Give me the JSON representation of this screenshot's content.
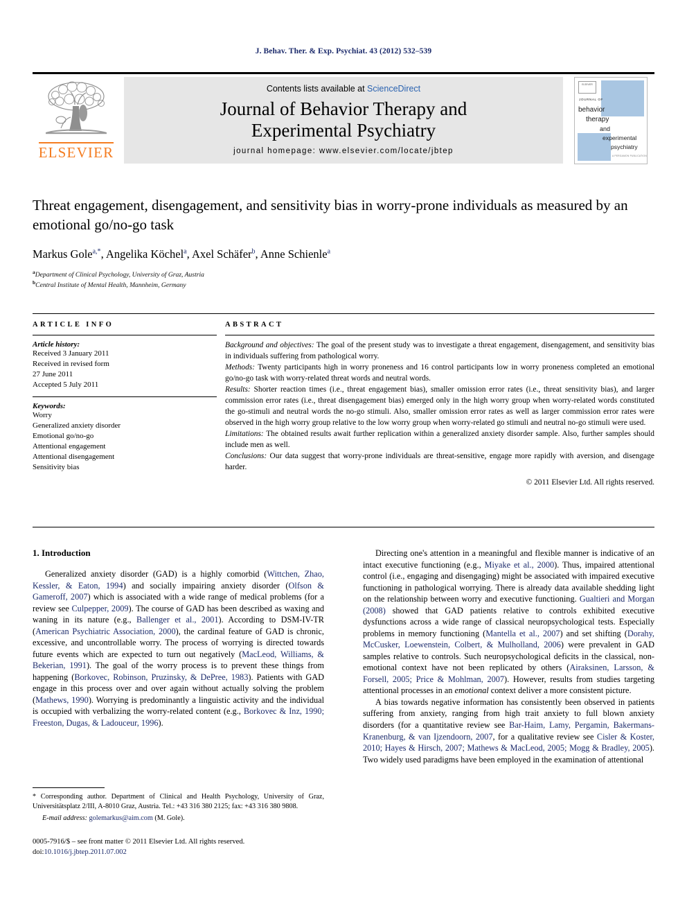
{
  "running_head": "J. Behav. Ther. & Exp. Psychiat. 43 (2012) 532–539",
  "masthead": {
    "publisher_logo_name": "elsevier-tree-logo",
    "publisher_wordmark": "ELSEVIER",
    "contents_prefix": "Contents lists available at ",
    "contents_link": "ScienceDirect",
    "journal_title_line1": "Journal of Behavior Therapy and",
    "journal_title_line2": "Experimental Psychiatry",
    "homepage": "journal homepage: www.elsevier.com/locate/jbtep",
    "cover": {
      "publisher_mark": "ELSEVIER",
      "kicker": "JOURNAL OF",
      "l1": "behavior",
      "l2": "therapy",
      "l3": "and",
      "l4": "experimental",
      "l5": "psychiatry",
      "footer": "A PERGAMON PUBLICATION"
    },
    "colors": {
      "elsevier_orange": "#f47c20",
      "link_blue": "#2b63b0",
      "band_gray": "#e6e6e6",
      "cover_blue": "#a9c6e2"
    }
  },
  "title": "Threat engagement, disengagement, and sensitivity bias in worry-prone individuals as measured by an emotional go/no-go task",
  "authors_html": "Markus Gole<sup class=\"star\">a,*</sup>, Angelika Köchel<sup>a</sup>, Axel Schäfer<sup>b</sup>, Anne Schienle<sup>a</sup>",
  "affiliations": [
    {
      "marker": "a",
      "text": "Department of Clinical Psychology, University of Graz, Austria"
    },
    {
      "marker": "b",
      "text": "Central Institute of Mental Health, Mannheim, Germany"
    }
  ],
  "article_info": {
    "heading": "ARTICLE INFO",
    "history_label": "Article history:",
    "history": [
      "Received 3 January 2011",
      "Received in revised form",
      "27 June 2011",
      "Accepted 5 July 2011"
    ],
    "keywords_label": "Keywords:",
    "keywords": [
      "Worry",
      "Generalized anxiety disorder",
      "Emotional go/no-go",
      "Attentional engagement",
      "Attentional disengagement",
      "Sensitivity bias"
    ]
  },
  "abstract": {
    "heading": "ABSTRACT",
    "sections": [
      {
        "label": "Background and objectives:",
        "text": " The goal of the present study was to investigate a threat engagement, disengagement, and sensitivity bias in individuals suffering from pathological worry."
      },
      {
        "label": "Methods:",
        "text": " Twenty participants high in worry proneness and 16 control participants low in worry proneness completed an emotional go/no-go task with worry-related threat words and neutral words."
      },
      {
        "label": "Results:",
        "text": " Shorter reaction times (i.e., threat engagement bias), smaller omission error rates (i.e., threat sensitivity bias), and larger commission error rates (i.e., threat disengagement bias) emerged only in the high worry group when worry-related words constituted the go-stimuli and neutral words the no-go stimuli. Also, smaller omission error rates as well as larger commission error rates were observed in the high worry group relative to the low worry group when worry-related go stimuli and neutral no-go stimuli were used."
      },
      {
        "label": "Limitations:",
        "text": " The obtained results await further replication within a generalized anxiety disorder sample. Also, further samples should include men as well."
      },
      {
        "label": "Conclusions:",
        "text": " Our data suggest that worry-prone individuals are threat-sensitive, engage more rapidly with aversion, and disengage harder."
      }
    ],
    "copyright": "© 2011 Elsevier Ltd. All rights reserved."
  },
  "body": {
    "section_number_title": "1. Introduction",
    "left_paragraphs": [
      "Generalized anxiety disorder (GAD) is a highly comorbid (<span class=\"ref\">Wittchen, Zhao, Kessler, & Eaton, 1994</span>) and socially impairing anxiety disorder (<span class=\"ref\">Olfson & Gameroff, 2007</span>) which is associated with a wide range of medical problems (for a review see <span class=\"ref\">Culpepper, 2009</span>). The course of GAD has been described as waxing and waning in its nature (e.g., <span class=\"ref\">Ballenger et al., 2001</span>). According to DSM-IV-TR (<span class=\"ref\">American Psychiatric Association, 2000</span>), the cardinal feature of GAD is chronic, excessive, and uncontrollable worry. The process of worrying is directed towards future events which are expected to turn out negatively (<span class=\"ref\">MacLeod, Williams, & Bekerian, 1991</span>). The goal of the worry process is to prevent these things from happening (<span class=\"ref\">Borkovec, Robinson, Pruzinsky, & DePree, 1983</span>). Patients with GAD engage in this process over and over again without actually solving the problem (<span class=\"ref\">Mathews, 1990</span>). Worrying is predominantly a linguistic activity and the individual is occupied with verbalizing the worry-related content (e.g., <span class=\"ref\">Borkovec & Inz, 1990; Freeston, Dugas, & Ladouceur, 1996</span>)."
    ],
    "right_paragraphs": [
      "Directing one's attention in a meaningful and flexible manner is indicative of an intact executive functioning (e.g., <span class=\"ref\">Miyake et al., 2000</span>). Thus, impaired attentional control (i.e., engaging and disengaging) might be associated with impaired executive functioning in pathological worrying. There is already data available shedding light on the relationship between worry and executive functioning. <span class=\"ref\">Gualtieri and Morgan (2008)</span> showed that GAD patients relative to controls exhibited executive dysfunctions across a wide range of classical neuropsychological tests. Especially problems in memory functioning (<span class=\"ref\">Mantella et al., 2007</span>) and set shifting (<span class=\"ref\">Dorahy, McCusker, Loewenstein, Colbert, & Mulholland, 2006</span>) were prevalent in GAD samples relative to controls. Such neuropsychological deficits in the classical, non-emotional context have not been replicated by others (<span class=\"ref\">Airaksinen, Larsson, & Forsell, 2005; Price & Mohlman, 2007</span>). However, results from studies targeting attentional processes in an <i>emotional</i> context deliver a more consistent picture.",
      "A bias towards negative information has consistently been observed in patients suffering from anxiety, ranging from high trait anxiety to full blown anxiety disorders (for a quantitative review see <span class=\"ref\">Bar-Haim, Lamy, Pergamin, Bakermans-Kranenburg, & van Ijzendoorn, 2007</span>, for a qualitative review see <span class=\"ref\">Cisler & Koster, 2010; Hayes & Hirsch, 2007; Mathews & MacLeod, 2005; Mogg & Bradley, 2005</span>). Two widely used paradigms have been employed in the examination of attentional"
    ]
  },
  "footnote": {
    "corresponding": "* Corresponding author. Department of Clinical and Health Psychology, University of Graz, Universitätsplatz 2/III, A-8010 Graz, Austria. Tel.: +43 316 380 2125; fax: +43 316 380 9808.",
    "email_label": "E-mail address:",
    "email": "golemarkus@aim.com",
    "email_suffix": " (M. Gole)."
  },
  "colophon": {
    "line1": "0005-7916/$ – see front matter © 2011 Elsevier Ltd. All rights reserved.",
    "doi_prefix": "doi:",
    "doi": "10.1016/j.jbtep.2011.07.002"
  }
}
